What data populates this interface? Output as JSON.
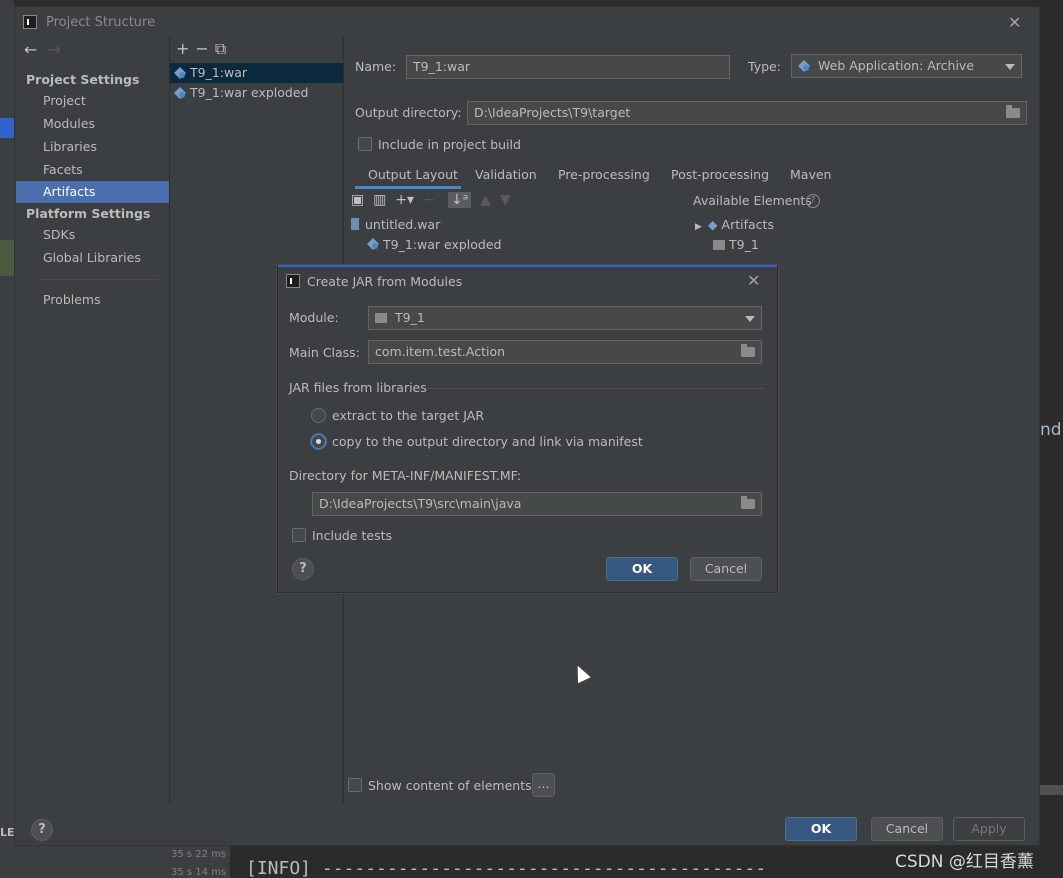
{
  "main_dialog": {
    "title": "Project Structure",
    "close": "✕"
  },
  "sidebar": {
    "project_settings_header": "Project Settings",
    "project_settings_items": [
      {
        "label": "Project"
      },
      {
        "label": "Modules"
      },
      {
        "label": "Libraries"
      },
      {
        "label": "Facets"
      },
      {
        "label": "Artifacts",
        "selected": true
      }
    ],
    "platform_settings_header": "Platform Settings",
    "platform_settings_items": [
      {
        "label": "SDKs"
      },
      {
        "label": "Global Libraries"
      }
    ],
    "problems": "Problems"
  },
  "artifact_list": {
    "items": [
      {
        "label": "T9_1:war",
        "selected": true
      },
      {
        "label": "T9_1:war exploded"
      }
    ]
  },
  "artifact_form": {
    "name_label": "Name:",
    "name_value": "T9_1:war",
    "type_label": "Type:",
    "type_value": "Web Application: Archive",
    "output_dir_label": "Output directory:",
    "output_dir_value": "D:\\IdeaProjects\\T9\\target",
    "include_build_label": "Include in project build",
    "include_build_checked": false,
    "tabs": [
      {
        "label": "Output Layout",
        "active": true
      },
      {
        "label": "Validation"
      },
      {
        "label": "Pre-processing"
      },
      {
        "label": "Post-processing"
      },
      {
        "label": "Maven"
      }
    ],
    "layout_tree": [
      {
        "label": "untitled.war"
      },
      {
        "label": "T9_1:war exploded"
      }
    ],
    "available_elements_label": "Available Elements",
    "available_tree": [
      {
        "label": "Artifacts"
      },
      {
        "label": "T9_1"
      }
    ],
    "show_content_label": "Show content of elements",
    "show_content_checked": false,
    "ellipsis_button": "..."
  },
  "main_footer": {
    "help": "?",
    "ok": "OK",
    "cancel": "Cancel",
    "apply": "Apply"
  },
  "jar_dialog": {
    "title": "Create JAR from Modules",
    "close": "✕",
    "module_label": "Module:",
    "module_value": "T9_1",
    "main_class_label": "Main Class:",
    "main_class_value": "com.item.test.Action",
    "jar_files_group": "JAR files from libraries",
    "radio_extract": "extract to the target JAR",
    "radio_copy": "copy to the output directory and link via manifest",
    "selected_option": "copy",
    "manifest_dir_label": "Directory for META-INF/MANIFEST.MF:",
    "manifest_dir_value": "D:\\IdeaProjects\\T9\\src\\main\\java",
    "include_tests_label": "Include tests",
    "include_tests_checked": false,
    "help": "?",
    "ok": "OK",
    "cancel": "Cancel"
  },
  "background": {
    "log_ms_1": "35 s 22 ms",
    "log_ms_2": "35 s 14 ms",
    "info_line": "[INFO] -----------------------------------------",
    "left_fragment": "LEA",
    "right_fragment": "ndE",
    "watermark": "CSDN @红目香薰"
  },
  "colors": {
    "accent": "#4b6eaf",
    "primary_button": "#365880",
    "dialog_bg": "#3c3f41",
    "field_bg": "#45494a"
  }
}
